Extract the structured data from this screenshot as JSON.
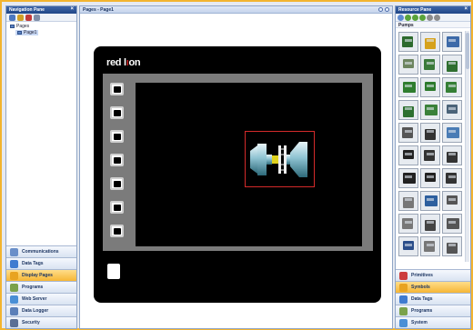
{
  "nav": {
    "title": "Navigation Pane",
    "close": "×",
    "tree": {
      "root": "Pages",
      "child": "Page1"
    },
    "buttons": [
      {
        "label": "Communications",
        "icon": "communications-icon",
        "color": "#6a8fc9"
      },
      {
        "label": "Data Tags",
        "icon": "data-tags-icon",
        "color": "#3f7bd0"
      },
      {
        "label": "Display Pages",
        "icon": "display-pages-icon",
        "color": "#e8a321",
        "active": true
      },
      {
        "label": "Programs",
        "icon": "programs-icon",
        "color": "#7aa24b"
      },
      {
        "label": "Web Server",
        "icon": "web-server-icon",
        "color": "#4a8fd5"
      },
      {
        "label": "Data Logger",
        "icon": "data-logger-icon",
        "color": "#5b7fb8"
      },
      {
        "label": "Security",
        "icon": "security-icon",
        "color": "#5a6f95"
      }
    ]
  },
  "editor": {
    "tab": "Pages - Page1",
    "brand": {
      "left": "red l",
      "right": "n"
    },
    "badge": [
      "",
      "",
      ""
    ]
  },
  "resource": {
    "title": "Resource Pane",
    "close": "×",
    "category": "Pumps",
    "symbols": [
      {
        "icon": "pump-array-icon",
        "color": "#2d6a2d"
      },
      {
        "icon": "pump-motor-yellow-icon",
        "color": "#d6a21b"
      },
      {
        "icon": "pump-motor-blue-icon",
        "color": "#3d6aa8"
      },
      {
        "icon": "pump-skid-icon",
        "color": "#6d8560"
      },
      {
        "icon": "pump-cabinet-icon",
        "color": "#3a7a3a"
      },
      {
        "icon": "pump-panel-icon",
        "color": "#2f6e2f"
      },
      {
        "icon": "pump-green-box-icon",
        "color": "#2f7d2f"
      },
      {
        "icon": "pump-green-tall-icon",
        "color": "#2c7a2c"
      },
      {
        "icon": "pump-green-vent-icon",
        "color": "#357f35"
      },
      {
        "icon": "pump-vertical-icon",
        "color": "#2d7030"
      },
      {
        "icon": "pump-horizontal-icon",
        "color": "#3a813a"
      },
      {
        "icon": "pump-grey-unit-icon",
        "color": "#4b6378"
      },
      {
        "icon": "pump-small-icon",
        "color": "#555"
      },
      {
        "icon": "pump-inline-icon",
        "color": "#333"
      },
      {
        "icon": "pump-blue-icon",
        "color": "#4a7cb5"
      },
      {
        "icon": "pump-dome-icon",
        "color": "#222"
      },
      {
        "icon": "pump-dome2-icon",
        "color": "#333"
      },
      {
        "icon": "pump-dome3-icon",
        "color": "#333"
      },
      {
        "icon": "pump-flat-icon",
        "color": "#222"
      },
      {
        "icon": "pump-tee-icon",
        "color": "#222"
      },
      {
        "icon": "pump-tee2-icon",
        "color": "#333"
      },
      {
        "icon": "pump-valve-icon",
        "color": "#777"
      },
      {
        "icon": "pump-meter-icon",
        "color": "#2d5f9e"
      },
      {
        "icon": "pump-meter2-icon",
        "color": "#555"
      },
      {
        "icon": "pump-display-icon",
        "color": "#777"
      },
      {
        "icon": "pump-display2-icon",
        "color": "#444"
      },
      {
        "icon": "pump-display3-icon",
        "color": "#555"
      },
      {
        "icon": "pump-gauge-icon",
        "color": "#2b4e8a"
      },
      {
        "icon": "pump-gauge2-icon",
        "color": "#777"
      },
      {
        "icon": "pump-gauge3-icon",
        "color": "#555"
      }
    ],
    "buttons": [
      {
        "label": "Primitives",
        "icon": "primitives-icon",
        "color": "#cc3d3d"
      },
      {
        "label": "Symbols",
        "icon": "symbols-icon",
        "color": "#e8a321",
        "active": true
      },
      {
        "label": "Data Tags",
        "icon": "data-tags-icon",
        "color": "#3f7bd0"
      },
      {
        "label": "Programs",
        "icon": "programs-icon",
        "color": "#7aa24b"
      },
      {
        "label": "System",
        "icon": "system-icon",
        "color": "#4a8fd5"
      }
    ]
  }
}
